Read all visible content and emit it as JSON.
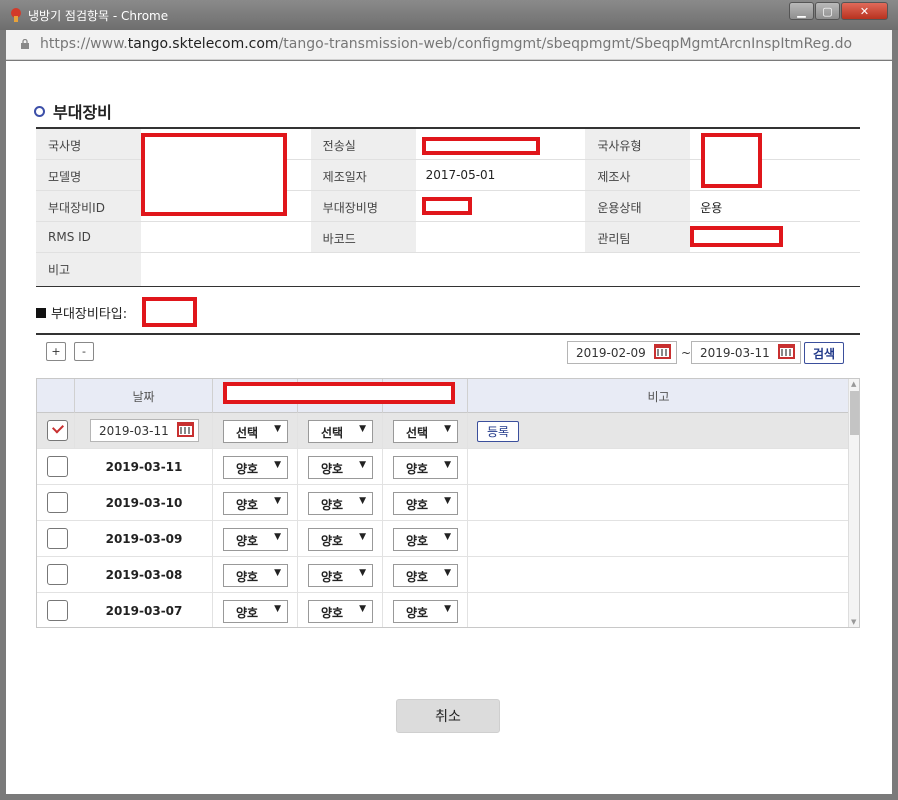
{
  "window": {
    "title": "냉방기 점검항목 - Chrome",
    "url_prefix": "https://www.",
    "url_host": "tango.sktelecom.com",
    "url_path": "/tango-transmission-web/configmgmt/sbeqpmgmt/SbeqpMgmtArcnInspItmReg.do"
  },
  "section": {
    "title": "부대장비"
  },
  "info": {
    "r1": {
      "l1": "국사명",
      "l2": "전송실",
      "l3": "국사유형"
    },
    "r2": {
      "l1": "모델명",
      "l2": "제조일자",
      "v2": "2017-05-01",
      "l3": "제조사"
    },
    "r3": {
      "l1": "부대장비ID",
      "l2": "부대장비명",
      "l3": "운용상태",
      "v3": "운용"
    },
    "r4": {
      "l1": "RMS ID",
      "l2": "바코드",
      "l3": "관리팀"
    },
    "r5": {
      "l1": "비고"
    }
  },
  "type_label": "부대장비타입:",
  "toolbar": {
    "add_label": "+",
    "remove_label": "-",
    "date_from": "2019-02-09",
    "tilde": "~",
    "date_to": "2019-03-11",
    "search_label": "검색"
  },
  "grid": {
    "headers": {
      "date": "날짜",
      "remark": "비고"
    },
    "input_row": {
      "date": "2019-03-11",
      "sel1": "선택",
      "sel2": "선택",
      "sel3": "선택",
      "register_label": "등록"
    },
    "rows": [
      {
        "date": "2019-03-11",
        "s1": "양호",
        "s2": "양호",
        "s3": "양호"
      },
      {
        "date": "2019-03-10",
        "s1": "양호",
        "s2": "양호",
        "s3": "양호"
      },
      {
        "date": "2019-03-09",
        "s1": "양호",
        "s2": "양호",
        "s3": "양호"
      },
      {
        "date": "2019-03-08",
        "s1": "양호",
        "s2": "양호",
        "s3": "양호"
      },
      {
        "date": "2019-03-07",
        "s1": "양호",
        "s2": "양호",
        "s3": "양호"
      }
    ]
  },
  "cancel_label": "취소",
  "colors": {
    "accent": "#3c4fa8",
    "redaction": "#e0161b",
    "header_bg": "#e8ebf5"
  }
}
